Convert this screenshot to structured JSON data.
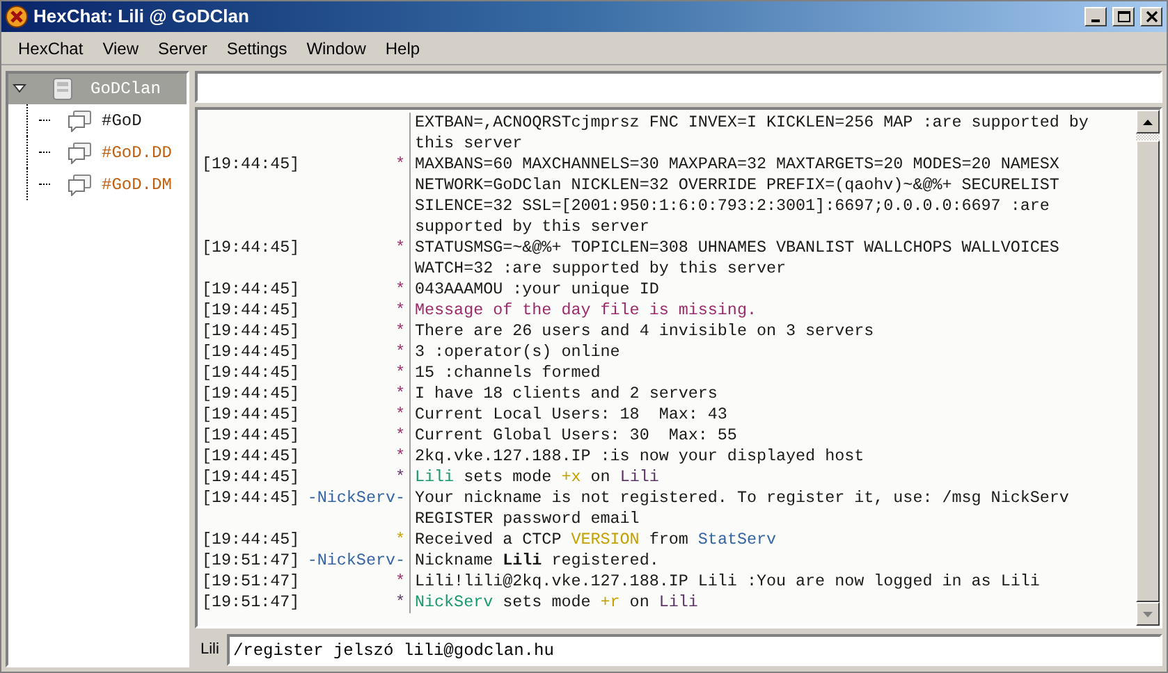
{
  "window": {
    "title": "HexChat: Lili @ GoDClan"
  },
  "menu": [
    "HexChat",
    "View",
    "Server",
    "Settings",
    "Window",
    "Help"
  ],
  "tree": {
    "label": "GoDClan",
    "selected": true,
    "expanded": true,
    "children": [
      {
        "label": "#GoD",
        "color": "#1a1a1a",
        "selected": false
      },
      {
        "label": "#GoD.DD",
        "color": "#c0600f",
        "selected": false
      },
      {
        "label": "#GoD.DM",
        "color": "#c0600f",
        "selected": false
      }
    ]
  },
  "messages": [
    {
      "segments": [
        {
          "text": "EXTBAN=,ACNOQRSTcjmprsz FNC INVEX=I KICKLEN=256 MAP :are supported by this server"
        }
      ]
    },
    {
      "time": "[19:44:45]",
      "nick": {
        "text": "*",
        "color": "#9c2b6b"
      },
      "segments": [
        {
          "text": "MAXBANS=60 MAXCHANNELS=30 MAXPARA=32 MAXTARGETS=20 MODES=20 NAMESX NETWORK=GoDClan NICKLEN=32 OVERRIDE PREFIX=(qaohv)~&@%+ SECURELIST SILENCE=32 SSL=[2001:950:1:6:0:793:2:3001]:6697;0.0.0.0:6697 :are supported by this server"
        }
      ]
    },
    {
      "time": "[19:44:45]",
      "nick": {
        "text": "*",
        "color": "#9c2b6b"
      },
      "segments": [
        {
          "text": "STATUSMSG=~&@%+ TOPICLEN=308 UHNAMES VBANLIST WALLCHOPS WALLVOICES WATCH=32 :are supported by this server"
        }
      ]
    },
    {
      "time": "[19:44:45]",
      "nick": {
        "text": "*",
        "color": "#9c2b6b"
      },
      "segments": [
        {
          "text": "043AAAMOU :your unique ID"
        }
      ]
    },
    {
      "time": "[19:44:45]",
      "nick": {
        "text": "*",
        "color": "#9c2b6b"
      },
      "segments": [
        {
          "text": "Message of the day file is missing.",
          "color": "#9c2b6b"
        }
      ]
    },
    {
      "time": "[19:44:45]",
      "nick": {
        "text": "*",
        "color": "#9c2b6b"
      },
      "segments": [
        {
          "text": "There are 26 users and 4 invisible on 3 servers"
        }
      ]
    },
    {
      "time": "[19:44:45]",
      "nick": {
        "text": "*",
        "color": "#9c2b6b"
      },
      "segments": [
        {
          "text": "3 :operator(s) online"
        }
      ]
    },
    {
      "time": "[19:44:45]",
      "nick": {
        "text": "*",
        "color": "#9c2b6b"
      },
      "segments": [
        {
          "text": "15 :channels formed"
        }
      ]
    },
    {
      "time": "[19:44:45]",
      "nick": {
        "text": "*",
        "color": "#9c2b6b"
      },
      "segments": [
        {
          "text": "I have 18 clients and 2 servers"
        }
      ]
    },
    {
      "time": "[19:44:45]",
      "nick": {
        "text": "*",
        "color": "#9c2b6b"
      },
      "segments": [
        {
          "text": "Current Local Users: 18  Max: 43"
        }
      ]
    },
    {
      "time": "[19:44:45]",
      "nick": {
        "text": "*",
        "color": "#9c2b6b"
      },
      "segments": [
        {
          "text": "Current Global Users: 30  Max: 55"
        }
      ]
    },
    {
      "time": "[19:44:45]",
      "nick": {
        "text": "*",
        "color": "#9c2b6b"
      },
      "segments": [
        {
          "text": "2kq.vke.127.188.IP :is now your displayed host"
        }
      ]
    },
    {
      "time": "[19:44:45]",
      "nick": {
        "text": "*",
        "color": "#5c3566"
      },
      "segments": [
        {
          "text": "Lili",
          "color": "#1a9a6a"
        },
        {
          "text": " sets mode "
        },
        {
          "text": "+x",
          "color": "#c4a000"
        },
        {
          "text": " on "
        },
        {
          "text": "Lili",
          "color": "#5c3566"
        }
      ]
    },
    {
      "time": "[19:44:45]",
      "nick": {
        "text": "-NickServ-",
        "color": "#3465a4"
      },
      "segments": [
        {
          "text": "Your nickname is not registered. To register it, use: /msg NickServ REGISTER password email"
        }
      ]
    },
    {
      "time": "[19:44:45]",
      "nick": {
        "text": "*",
        "color": "#c4a000"
      },
      "segments": [
        {
          "text": "Received a CTCP "
        },
        {
          "text": "VERSION",
          "color": "#c4a000"
        },
        {
          "text": " from "
        },
        {
          "text": "StatServ",
          "color": "#3465a4"
        }
      ]
    },
    {
      "time": "[19:51:47]",
      "nick": {
        "text": "-NickServ-",
        "color": "#3465a4"
      },
      "segments": [
        {
          "text": "Nickname **Lili** registered."
        }
      ]
    },
    {
      "time": "[19:51:47]",
      "nick": {
        "text": "*",
        "color": "#9c2b6b"
      },
      "segments": [
        {
          "text": "Lili!lili@2kq.vke.127.188.IP Lili :You are now logged in as Lili"
        }
      ]
    },
    {
      "time": "[19:51:47]",
      "nick": {
        "text": "*",
        "color": "#5c3566"
      },
      "segments": [
        {
          "text": "NickServ",
          "color": "#1a9a6a"
        },
        {
          "text": " sets mode "
        },
        {
          "text": "+r",
          "color": "#c4a000"
        },
        {
          "text": " on "
        },
        {
          "text": "Lili",
          "color": "#5c3566"
        }
      ]
    }
  ],
  "input": {
    "nick": "Lili",
    "value": "/register jelszó lili@godclan.hu"
  }
}
